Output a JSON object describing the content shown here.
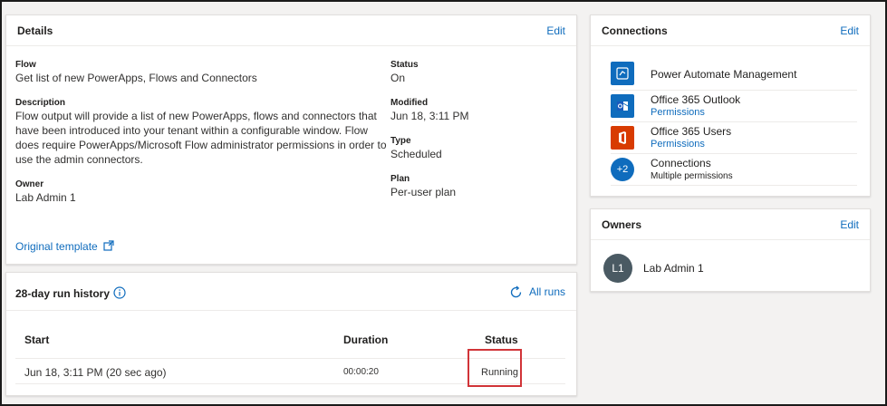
{
  "details": {
    "title": "Details",
    "edit_label": "Edit",
    "flow_label": "Flow",
    "flow_value": "Get list of new PowerApps, Flows and Connectors",
    "description_label": "Description",
    "description_lines": [
      "Flow output will provide a list of new PowerApps, flows and connectors that",
      "have been introduced into your tenant within a configurable window. Flow",
      "does require PowerApps/Microsoft Flow administrator permissions in order to",
      "use the admin connectors."
    ],
    "owner_label": "Owner",
    "owner_value": "Lab Admin 1",
    "status_label": "Status",
    "status_value": "On",
    "modified_label": "Modified",
    "modified_value": "Jun 18, 3:11 PM",
    "type_label": "Type",
    "type_value": "Scheduled",
    "plan_label": "Plan",
    "plan_value": "Per-user plan",
    "original_template_label": "Original template"
  },
  "connections": {
    "title": "Connections",
    "edit_label": "Edit",
    "items": [
      {
        "name": "Power Automate Management",
        "sub": "",
        "icon": "power-automate-management-icon",
        "color": "#0f6cbd"
      },
      {
        "name": "Office 365 Outlook",
        "sub": "Permissions",
        "icon": "outlook-icon",
        "color": "#0f6cbd"
      },
      {
        "name": "Office 365 Users",
        "sub": "Permissions",
        "icon": "office-icon",
        "color": "#d83b01"
      },
      {
        "name": "Connections",
        "sub": "Multiple permissions",
        "icon": "more-connections-icon",
        "badge": "+2",
        "color": "#0f6cbd"
      }
    ]
  },
  "owners": {
    "title": "Owners",
    "edit_label": "Edit",
    "owner_initials": "L1",
    "owner_name": "Lab Admin 1"
  },
  "run_history": {
    "title": "28-day run history",
    "all_runs_label": "All runs",
    "columns": [
      "Start",
      "Duration",
      "Status"
    ],
    "rows": [
      {
        "start": "Jun 18, 3:11 PM (20 sec ago)",
        "duration": "00:00:20",
        "status": "Running"
      }
    ]
  },
  "colors": {
    "link": "#0f6cbd",
    "highlight": "#d13438",
    "avatar": "#4a5a63"
  }
}
